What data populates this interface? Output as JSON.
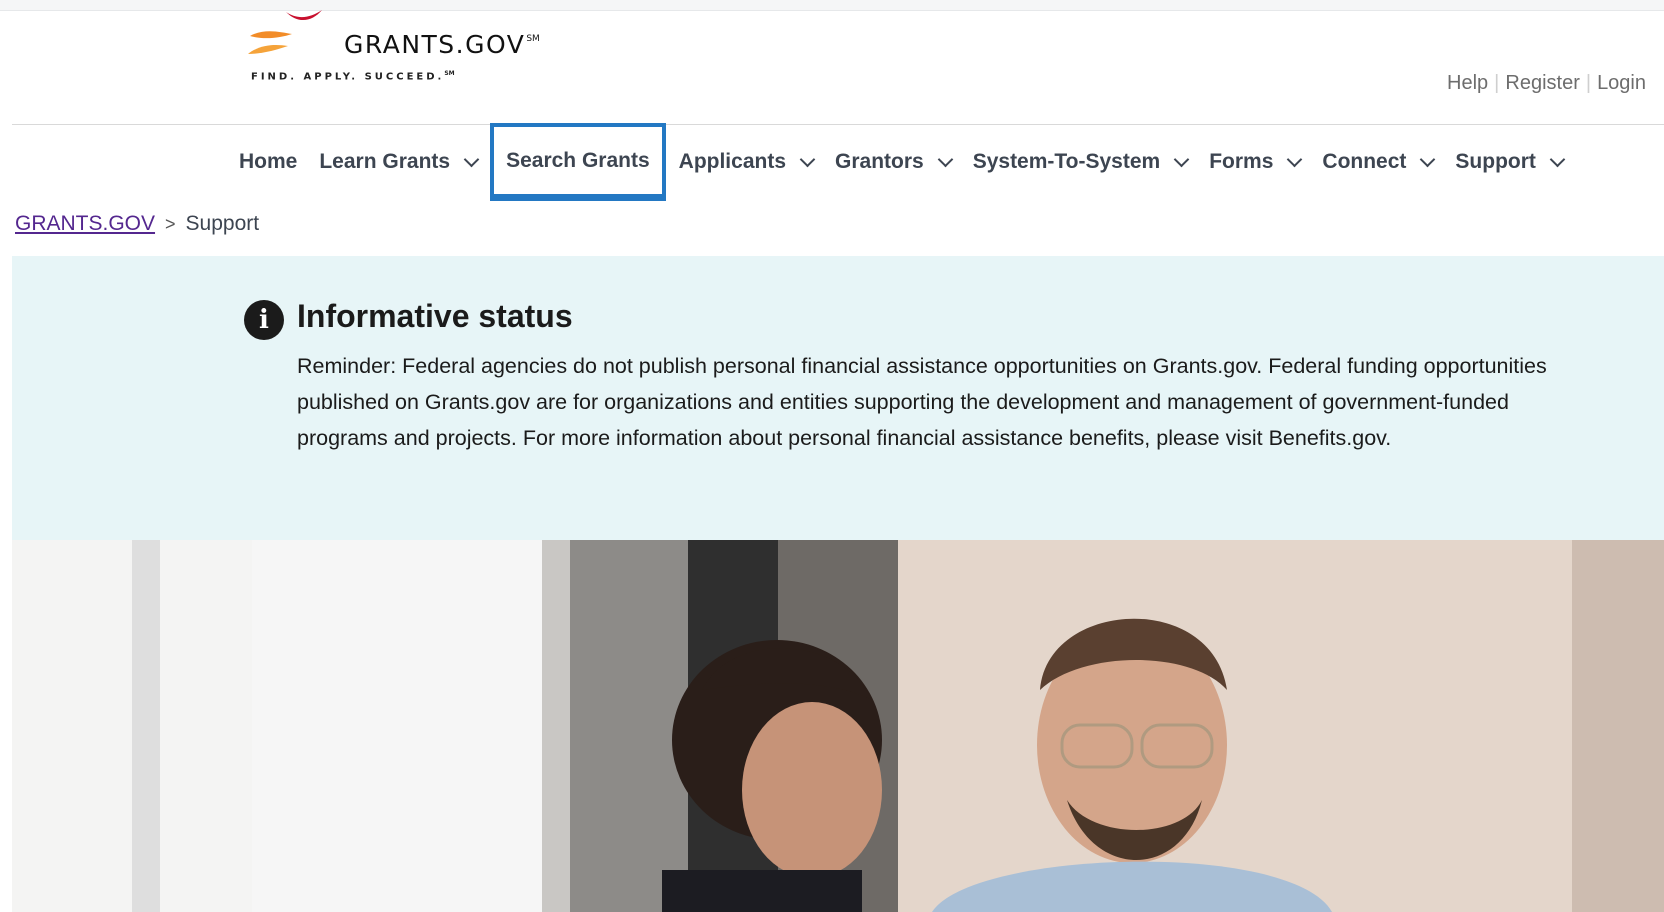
{
  "header": {
    "logo_text": "GRANTS.GOV",
    "logo_sm": "SM",
    "logo_tagline": "FIND. APPLY. SUCCEED.",
    "logo_tagline_sm": "SM",
    "util_links": {
      "help": "Help",
      "register": "Register",
      "login": "Login"
    }
  },
  "nav": {
    "items": [
      {
        "label": "Home",
        "has_dropdown": false
      },
      {
        "label": "Learn Grants",
        "has_dropdown": true
      },
      {
        "label": "Search Grants",
        "has_dropdown": false,
        "focused": true
      },
      {
        "label": "Applicants",
        "has_dropdown": true
      },
      {
        "label": "Grantors",
        "has_dropdown": true
      },
      {
        "label": "System-To-System",
        "has_dropdown": true
      },
      {
        "label": "Forms",
        "has_dropdown": true
      },
      {
        "label": "Connect",
        "has_dropdown": true
      },
      {
        "label": "Support",
        "has_dropdown": true
      }
    ]
  },
  "breadcrumb": {
    "root": "GRANTS.GOV",
    "separator": ">",
    "current": "Support"
  },
  "alert": {
    "icon": "info-icon",
    "title": "Informative status",
    "body": "Reminder: Federal agencies do not publish personal financial assistance opportunities on Grants.gov. Federal funding opportunities published on Grants.gov are for organizations and entities supporting the development and management of government-funded programs and projects. For more information about personal financial assistance benefits, please visit Benefits.gov."
  },
  "colors": {
    "focus_outline": "#2378c3",
    "alert_bg": "#e7f5f7",
    "breadcrumb_link": "#54278f",
    "nav_text": "#3d4551"
  }
}
